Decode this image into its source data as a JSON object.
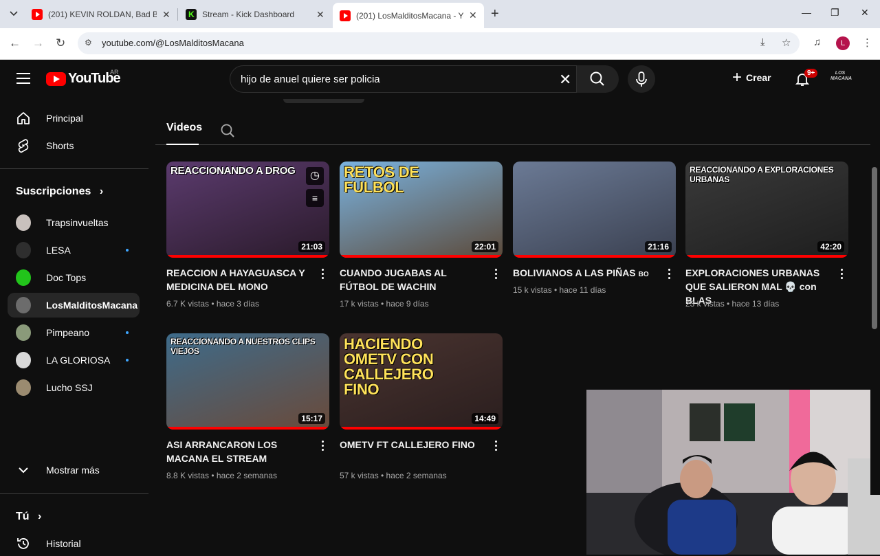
{
  "browser": {
    "tabs": [
      {
        "title": "(201) KEVIN ROLDAN, Bad Bunny",
        "favicon": "youtube-icon"
      },
      {
        "title": "Stream - Kick Dashboard",
        "favicon": "kick-icon"
      },
      {
        "title": "(201) LosMalditosMacana - YouTube",
        "favicon": "youtube-icon"
      }
    ],
    "url": "youtube.com/@LosMalditosMacana",
    "profile_initial": "L"
  },
  "youtube": {
    "logo_text": "YouTube",
    "country_code": "AR",
    "search_query": "hijo de anuel quiere ser policia",
    "create_label": "Crear",
    "notifications_badge": "9+",
    "avatar_text": "LOS MACANA"
  },
  "sidebar": {
    "nav": [
      {
        "label": "Principal",
        "icon": "home-icon"
      },
      {
        "label": "Shorts",
        "icon": "shorts-icon"
      }
    ],
    "subscriptions_header": "Suscripciones",
    "subscriptions": [
      {
        "label": "Trapsinvueltas",
        "color": "#c9c1bd",
        "new": false
      },
      {
        "label": "LESA",
        "color": "#2e2e2e",
        "new": true
      },
      {
        "label": "Doc Tops",
        "color": "#22c41b",
        "new": false
      },
      {
        "label": "LosMalditosMacana",
        "color": "#6c6c6c",
        "new": false,
        "active": true
      },
      {
        "label": "Pimpeano",
        "color": "#8a9a7a",
        "new": true
      },
      {
        "label": "LA GLORIOSA",
        "color": "#d8d8d8",
        "new": true
      },
      {
        "label": "Lucho SSJ",
        "color": "#9b8b70",
        "new": false
      }
    ],
    "show_more": "Mostrar más",
    "you_header": "Tú",
    "history": "Historial"
  },
  "channel_tabs": {
    "videos": "Videos"
  },
  "videos": [
    {
      "thumb_text": "REACCIONANDO A DROG",
      "duration": "21:03",
      "title": "REACCION A HAYAGUASCA Y MEDICINA DEL MONO",
      "meta": "6.7 K vistas • hace 3 días",
      "colors": [
        "#5b3b6e",
        "#2a1a2a"
      ]
    },
    {
      "thumb_text": "RETOS DE FULBOL",
      "duration": "22:01",
      "title": "CUANDO JUGABAS AL FÚTBOL DE WACHIN",
      "meta": "17 k vistas • hace 9 días",
      "colors": [
        "#7ab3e0",
        "#5c4a3a"
      ]
    },
    {
      "thumb_text": "",
      "duration": "21:16",
      "title": "BOLIVIANOS A LAS PIÑAS",
      "title_suffix": "BO",
      "meta": "15 k vistas • hace 11 días",
      "colors": [
        "#6b7a95",
        "#3a4050"
      ]
    },
    {
      "thumb_text": "REACCIONANDO A EXPLORACIONES URBANAS",
      "duration": "42:20",
      "title": "EXPLORACIONES URBANAS QUE SALIERON MAL 💀 con BLAS",
      "meta": "23 k vistas • hace 13 días",
      "colors": [
        "#3a3a3a",
        "#1e1e1e"
      ]
    },
    {
      "thumb_text": "REACCIONANDO A NUESTROS CLIPS VIEJOS",
      "duration": "15:17",
      "title": "ASI ARRANCARON LOS MACANA EL STREAM",
      "meta": "8.8 K vistas • hace 2 semanas",
      "colors": [
        "#3e6b8a",
        "#6a4a3a"
      ]
    },
    {
      "thumb_text": "HACIENDO OMETV CON CALLEJERO FINO",
      "duration": "14:49",
      "title": "OMETV FT CALLEJERO FINO",
      "meta": "57 k vistas • hace 2 semanas",
      "colors": [
        "#4a3430",
        "#2a1e1e"
      ]
    }
  ]
}
